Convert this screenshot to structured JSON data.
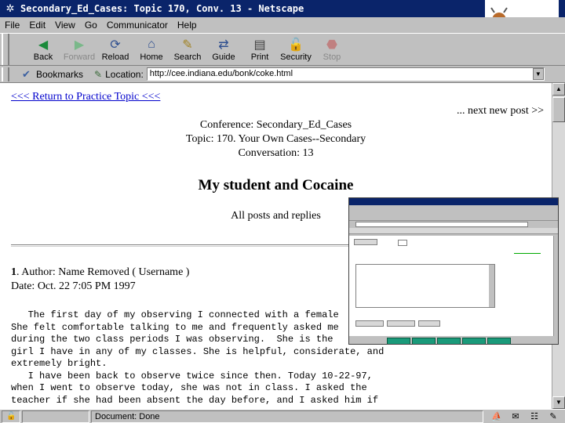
{
  "window": {
    "title": "Secondary_Ed_Cases: Topic 170, Conv. 13 - Netscape"
  },
  "menu": {
    "items": [
      "File",
      "Edit",
      "View",
      "Go",
      "Communicator",
      "Help"
    ]
  },
  "toolbar": {
    "buttons": [
      {
        "label": "Back",
        "icon": "back-arrow-icon",
        "enabled": true
      },
      {
        "label": "Forward",
        "icon": "forward-arrow-icon",
        "enabled": false
      },
      {
        "label": "Reload",
        "icon": "reload-icon",
        "enabled": true
      },
      {
        "label": "Home",
        "icon": "home-icon",
        "enabled": true
      },
      {
        "label": "Search",
        "icon": "search-icon",
        "enabled": true
      },
      {
        "label": "Guide",
        "icon": "guide-icon",
        "enabled": true
      },
      {
        "label": "Print",
        "icon": "print-icon",
        "enabled": true
      },
      {
        "label": "Security",
        "icon": "lock-icon",
        "enabled": true
      },
      {
        "label": "Stop",
        "icon": "stop-icon",
        "enabled": false
      }
    ]
  },
  "location": {
    "bookmarks_label": "Bookmarks",
    "location_label": "Location:",
    "url": "http://cee.indiana.edu/bonk/coke.html"
  },
  "page": {
    "return_link": "<<< Return to Practice Topic <<<",
    "next_link": "... next new post >>",
    "conference": "Conference: Secondary_Ed_Cases",
    "topic": "Topic: 170. Your Own Cases--Secondary",
    "conversation": "Conversation: 13",
    "post_title": "My student and Cocaine",
    "all_posts": "All posts and replies",
    "author_num": "1",
    "author": ". Author: Name Removed ( Username )",
    "date": "Date: Oct. 22 7:05 PM 1997",
    "body": "   The first day of my observing I connected with a female\nShe felt comfortable talking to me and frequently asked me\nduring the two class periods I was observing.  She is the\ngirl I have in any of my classes. She is helpful, considerate, and\nextremely bright.\n   I have been back to observe twice since then. Today 10-22-97,\nwhen I went to observe today, she was not in class. I asked the\nteacher if she had been absent the day before, and I asked him if"
  },
  "status": {
    "text": "Document: Done"
  },
  "colors": {
    "titlebar": "#0a246a",
    "chrome": "#c0c0c0",
    "link": "#0000cc",
    "inset_buttons": "#1a9a7a"
  }
}
